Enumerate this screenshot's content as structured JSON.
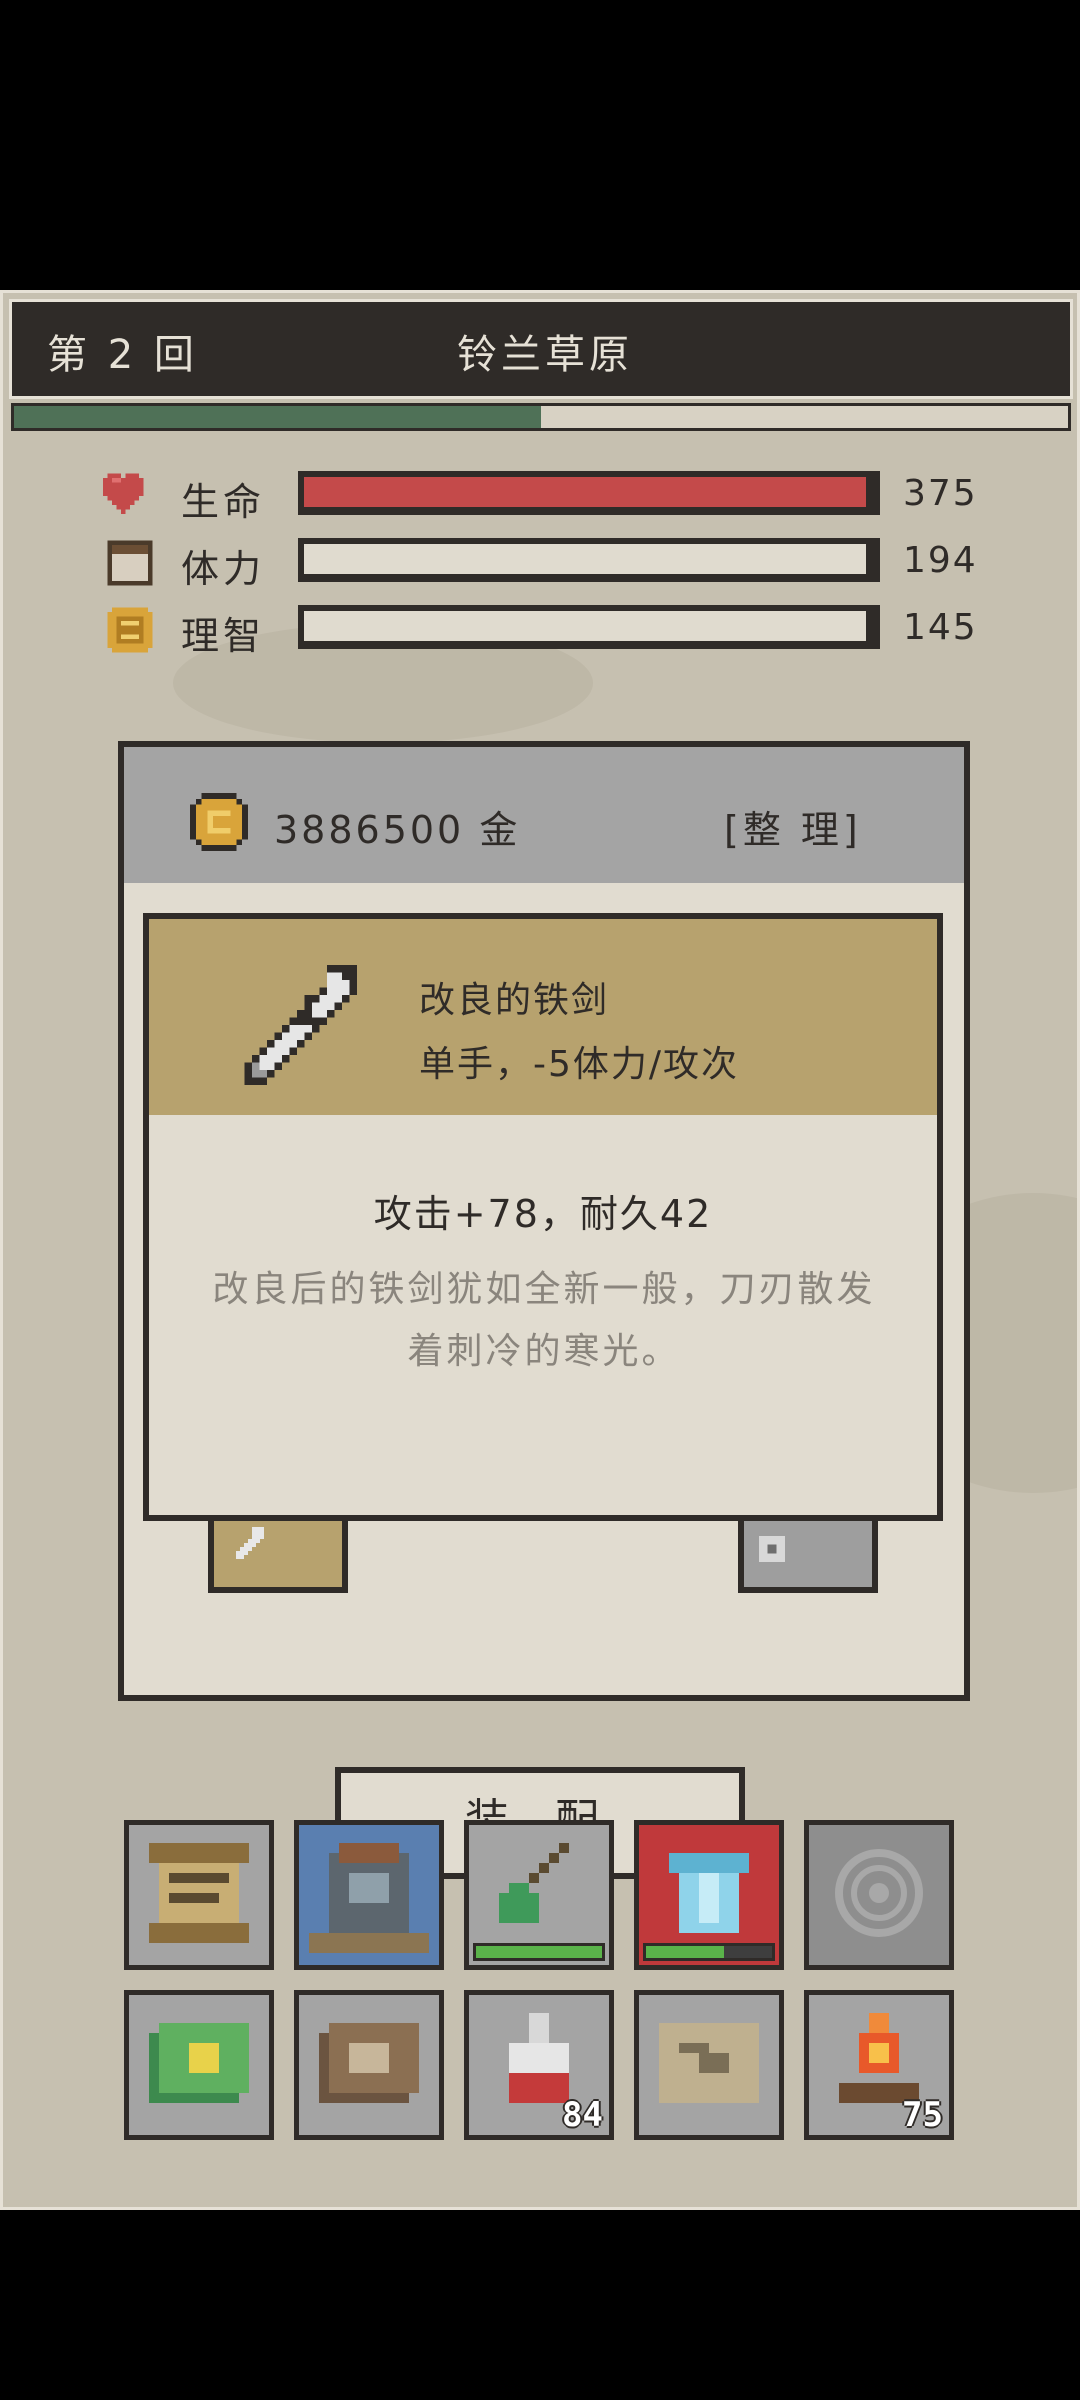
{
  "header": {
    "round": "第 2 回",
    "area": "铃兰草原"
  },
  "progress": {
    "value": 0.5
  },
  "stats": [
    {
      "label": "生命",
      "value": "375",
      "fill": 1.0,
      "color": "#c44a4a",
      "icon": "heart-icon"
    },
    {
      "label": "体力",
      "value": "194",
      "fill": 0.0,
      "color": "#e0dbcf",
      "icon": "stamina-icon"
    },
    {
      "label": "理智",
      "value": "145",
      "fill": 0.0,
      "color": "#e0dbcf",
      "icon": "sanity-icon"
    }
  ],
  "inventory": {
    "gold": "3886500 金",
    "sort_label": "[整 理]"
  },
  "item": {
    "name": "改良的铁剑",
    "type": "单手，-5体力/攻次",
    "stats": "攻击+78，耐久42",
    "description": "改良后的铁剑犹如全新一般，刀刃散发着刺冷的寒光。",
    "icon": "sword-icon"
  },
  "equip_label": "装 配",
  "toolbar_row1": [
    {
      "icon": "scroll-icon",
      "bg": "#a4a4a4",
      "bar": null
    },
    {
      "icon": "backpack-icon",
      "bg": "#5a7fb0",
      "bar": null
    },
    {
      "icon": "shovel-icon",
      "bg": "#a4a4a4",
      "bar": 1.0
    },
    {
      "icon": "armor-icon",
      "bg": "#c0393b",
      "bar": 0.62
    },
    {
      "icon": "rune-icon",
      "bg": "#8e8e8e",
      "bar": null
    }
  ],
  "toolbar_row2": [
    {
      "icon": "spellbook-icon",
      "count": ""
    },
    {
      "icon": "journal-icon",
      "count": ""
    },
    {
      "icon": "potion-icon",
      "count": "84"
    },
    {
      "icon": "map-icon",
      "count": ""
    },
    {
      "icon": "campfire-icon",
      "count": "75"
    }
  ]
}
